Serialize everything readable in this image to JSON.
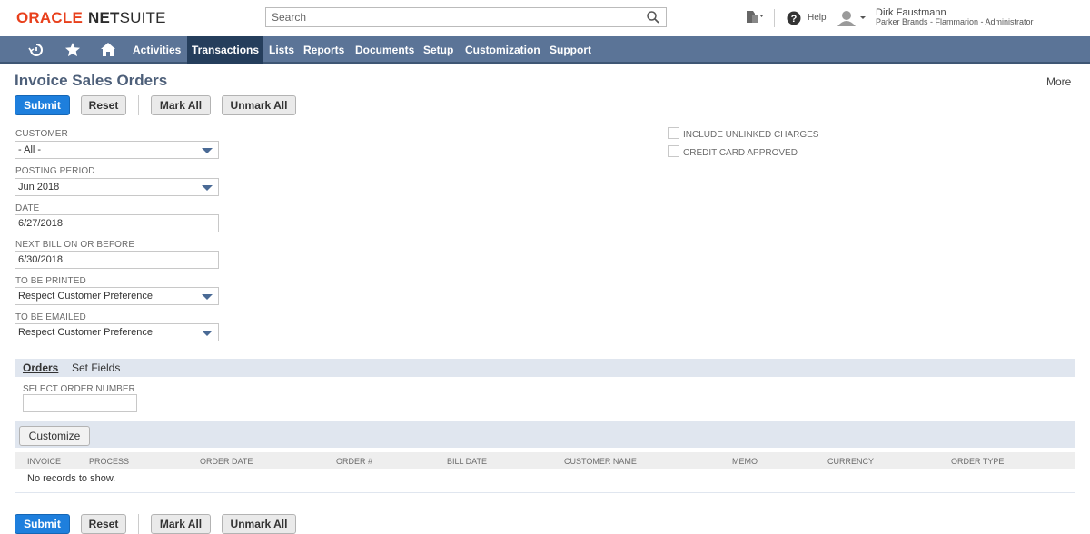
{
  "header": {
    "logo_oracle": "ORACLE",
    "logo_net": "NET",
    "logo_suite": "SUITE",
    "search_placeholder": "Search",
    "help_label": "Help",
    "user_name": "Dirk Faustmann",
    "user_role": "Parker Brands - Flammarion - Administrator"
  },
  "nav": {
    "items": [
      "Activities",
      "Transactions",
      "Lists",
      "Reports",
      "Documents",
      "Setup",
      "Customization",
      "Support"
    ],
    "active": "Transactions"
  },
  "page": {
    "title": "Invoice Sales Orders",
    "more": "More"
  },
  "buttons": {
    "submit": "Submit",
    "reset": "Reset",
    "mark_all": "Mark All",
    "unmark_all": "Unmark All"
  },
  "fields": {
    "customer": {
      "label": "CUSTOMER",
      "value": "- All -"
    },
    "posting_period": {
      "label": "POSTING PERIOD",
      "value": "Jun 2018"
    },
    "date": {
      "label": "DATE",
      "value": "6/27/2018"
    },
    "next_bill": {
      "label": "NEXT BILL ON OR BEFORE",
      "value": "6/30/2018"
    },
    "to_be_printed": {
      "label": "TO BE PRINTED",
      "value": "Respect Customer Preference"
    },
    "to_be_emailed": {
      "label": "TO BE EMAILED",
      "value": "Respect Customer Preference"
    }
  },
  "checkboxes": {
    "include_unlinked": {
      "label": "INCLUDE UNLINKED CHARGES",
      "checked": false
    },
    "cc_approved": {
      "label": "CREDIT CARD APPROVED",
      "checked": false
    }
  },
  "sublist": {
    "tabs": [
      "Orders",
      "Set Fields"
    ],
    "active_tab": "Orders",
    "select_order_label": "SELECT ORDER NUMBER",
    "select_order_value": "",
    "customize_label": "Customize",
    "columns": [
      "INVOICE",
      "PROCESS",
      "ORDER DATE",
      "ORDER #",
      "BILL DATE",
      "CUSTOMER NAME",
      "MEMO",
      "CURRENCY",
      "ORDER TYPE"
    ],
    "empty_message": "No records to show."
  },
  "colors": {
    "nav_bg": "#5b7497",
    "nav_active": "#253e5c",
    "primary_button": "#1e7fdd",
    "title": "#4d5f79",
    "logo_red": "#e8401c"
  }
}
